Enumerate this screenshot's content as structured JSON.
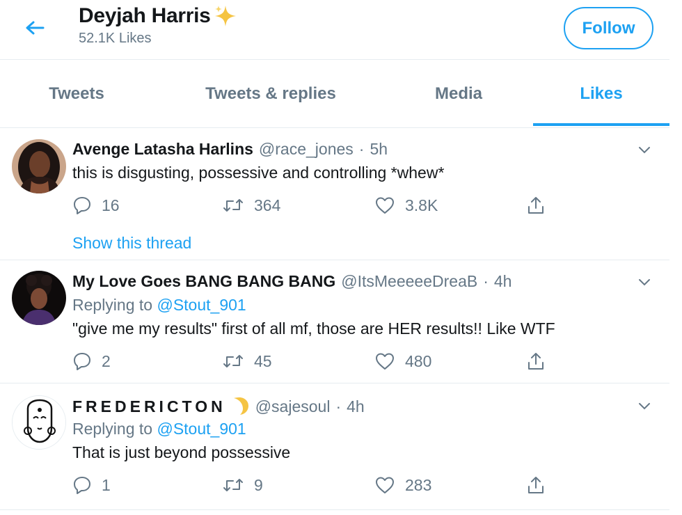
{
  "header": {
    "title": "Deyjah Harris",
    "title_emoji": "sparkles-icon",
    "likes_count": "52.1K Likes",
    "follow_label": "Follow",
    "accent": "#1da1f2"
  },
  "tabs": [
    {
      "label": "Tweets",
      "active": false
    },
    {
      "label": "Tweets & replies",
      "active": false
    },
    {
      "label": "Media",
      "active": false
    },
    {
      "label": "Likes",
      "active": true
    }
  ],
  "tweets": [
    {
      "name": "Avenge Latasha Harlins",
      "handle": "@race_jones",
      "dot": "·",
      "time": "5h",
      "replying_to": "",
      "text": "this is disgusting, possessive and controlling *whew*",
      "replies": "16",
      "retweets": "364",
      "likes": "3.8K",
      "thread_link": "Show this thread"
    },
    {
      "name": "My Love Goes BANG BANG BANG",
      "handle": "@ItsMeeeeeDreaB",
      "dot": "·",
      "time": "4h",
      "replying_prefix": "Replying to ",
      "replying_to": "@Stout_901",
      "text": "\"give me my results\" first of all mf, those are HER results!! Like WTF",
      "replies": "2",
      "retweets": "45",
      "likes": "480"
    },
    {
      "name": "FREDERICTON",
      "name_emoji": "crescent-moon-icon",
      "handle": "@sajesoul",
      "dot": "·",
      "time": "4h",
      "replying_prefix": "Replying to ",
      "replying_to": "@Stout_901",
      "text": "That is just beyond possessive",
      "replies": "1",
      "retweets": "9",
      "likes": "283"
    }
  ]
}
